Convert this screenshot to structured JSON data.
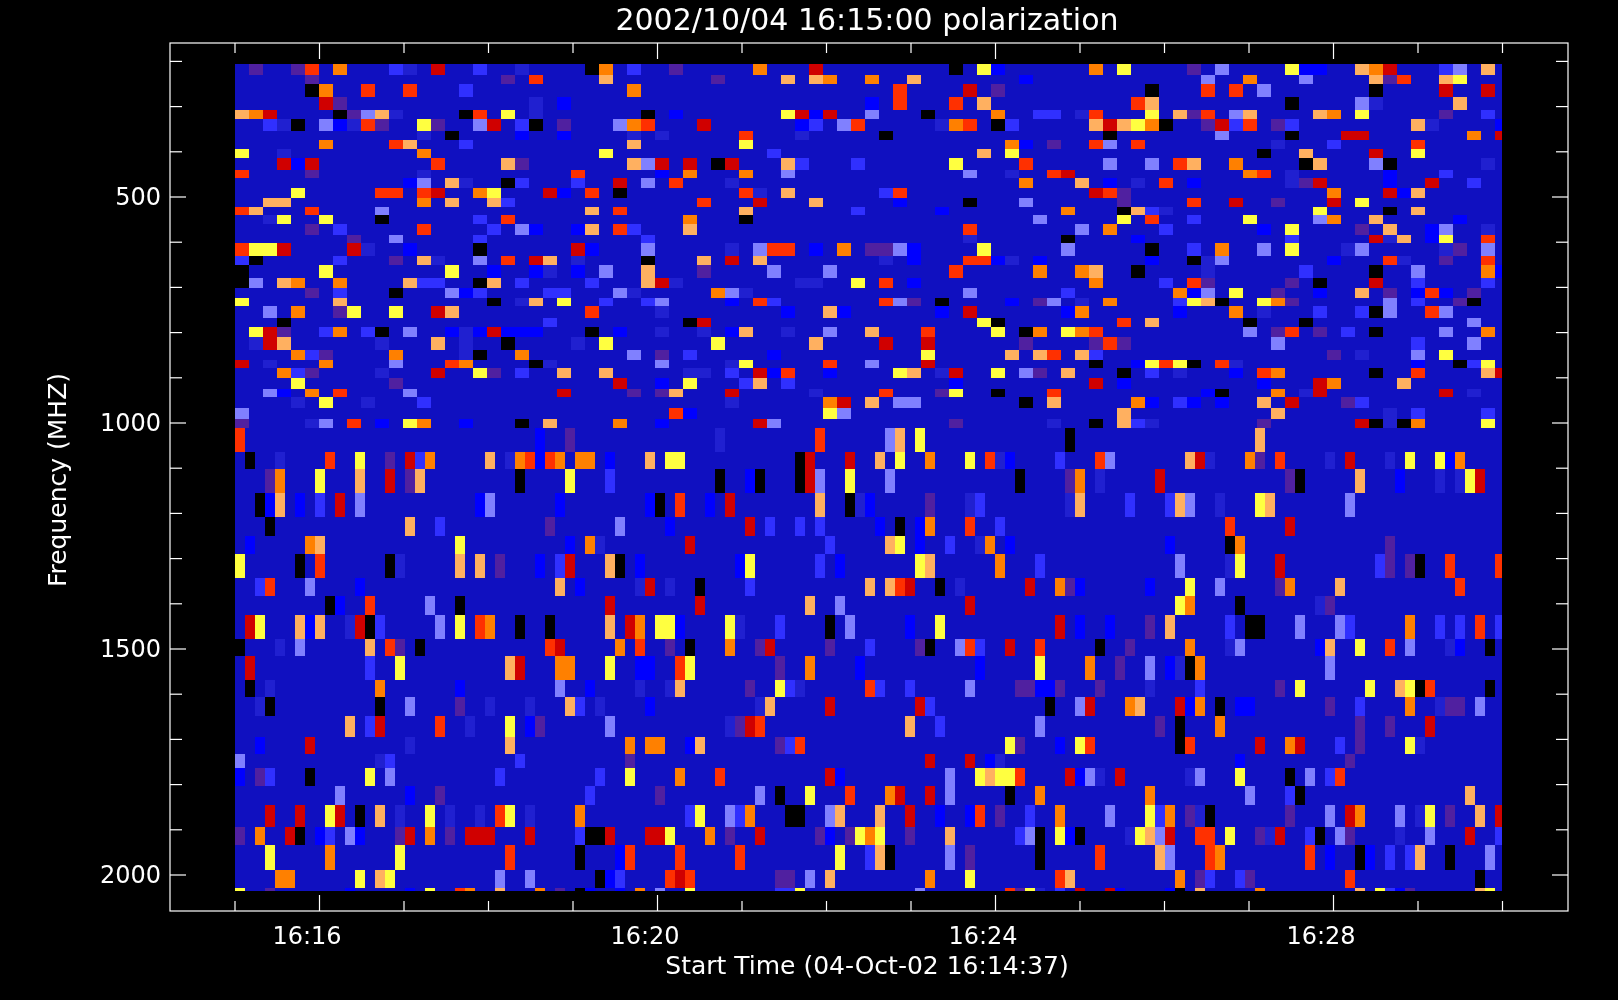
{
  "plot": {
    "title": "2002/10/04 16:15:00 polarization",
    "ylabel": "Frequency (MHZ)",
    "xlabel": "Start Time (04-Oct-02 16:14:37)",
    "yticks": [
      "500",
      "1000",
      "1500",
      "2000"
    ],
    "xticks": [
      "16:16",
      "16:20",
      "16:24",
      "16:28"
    ]
  }
}
